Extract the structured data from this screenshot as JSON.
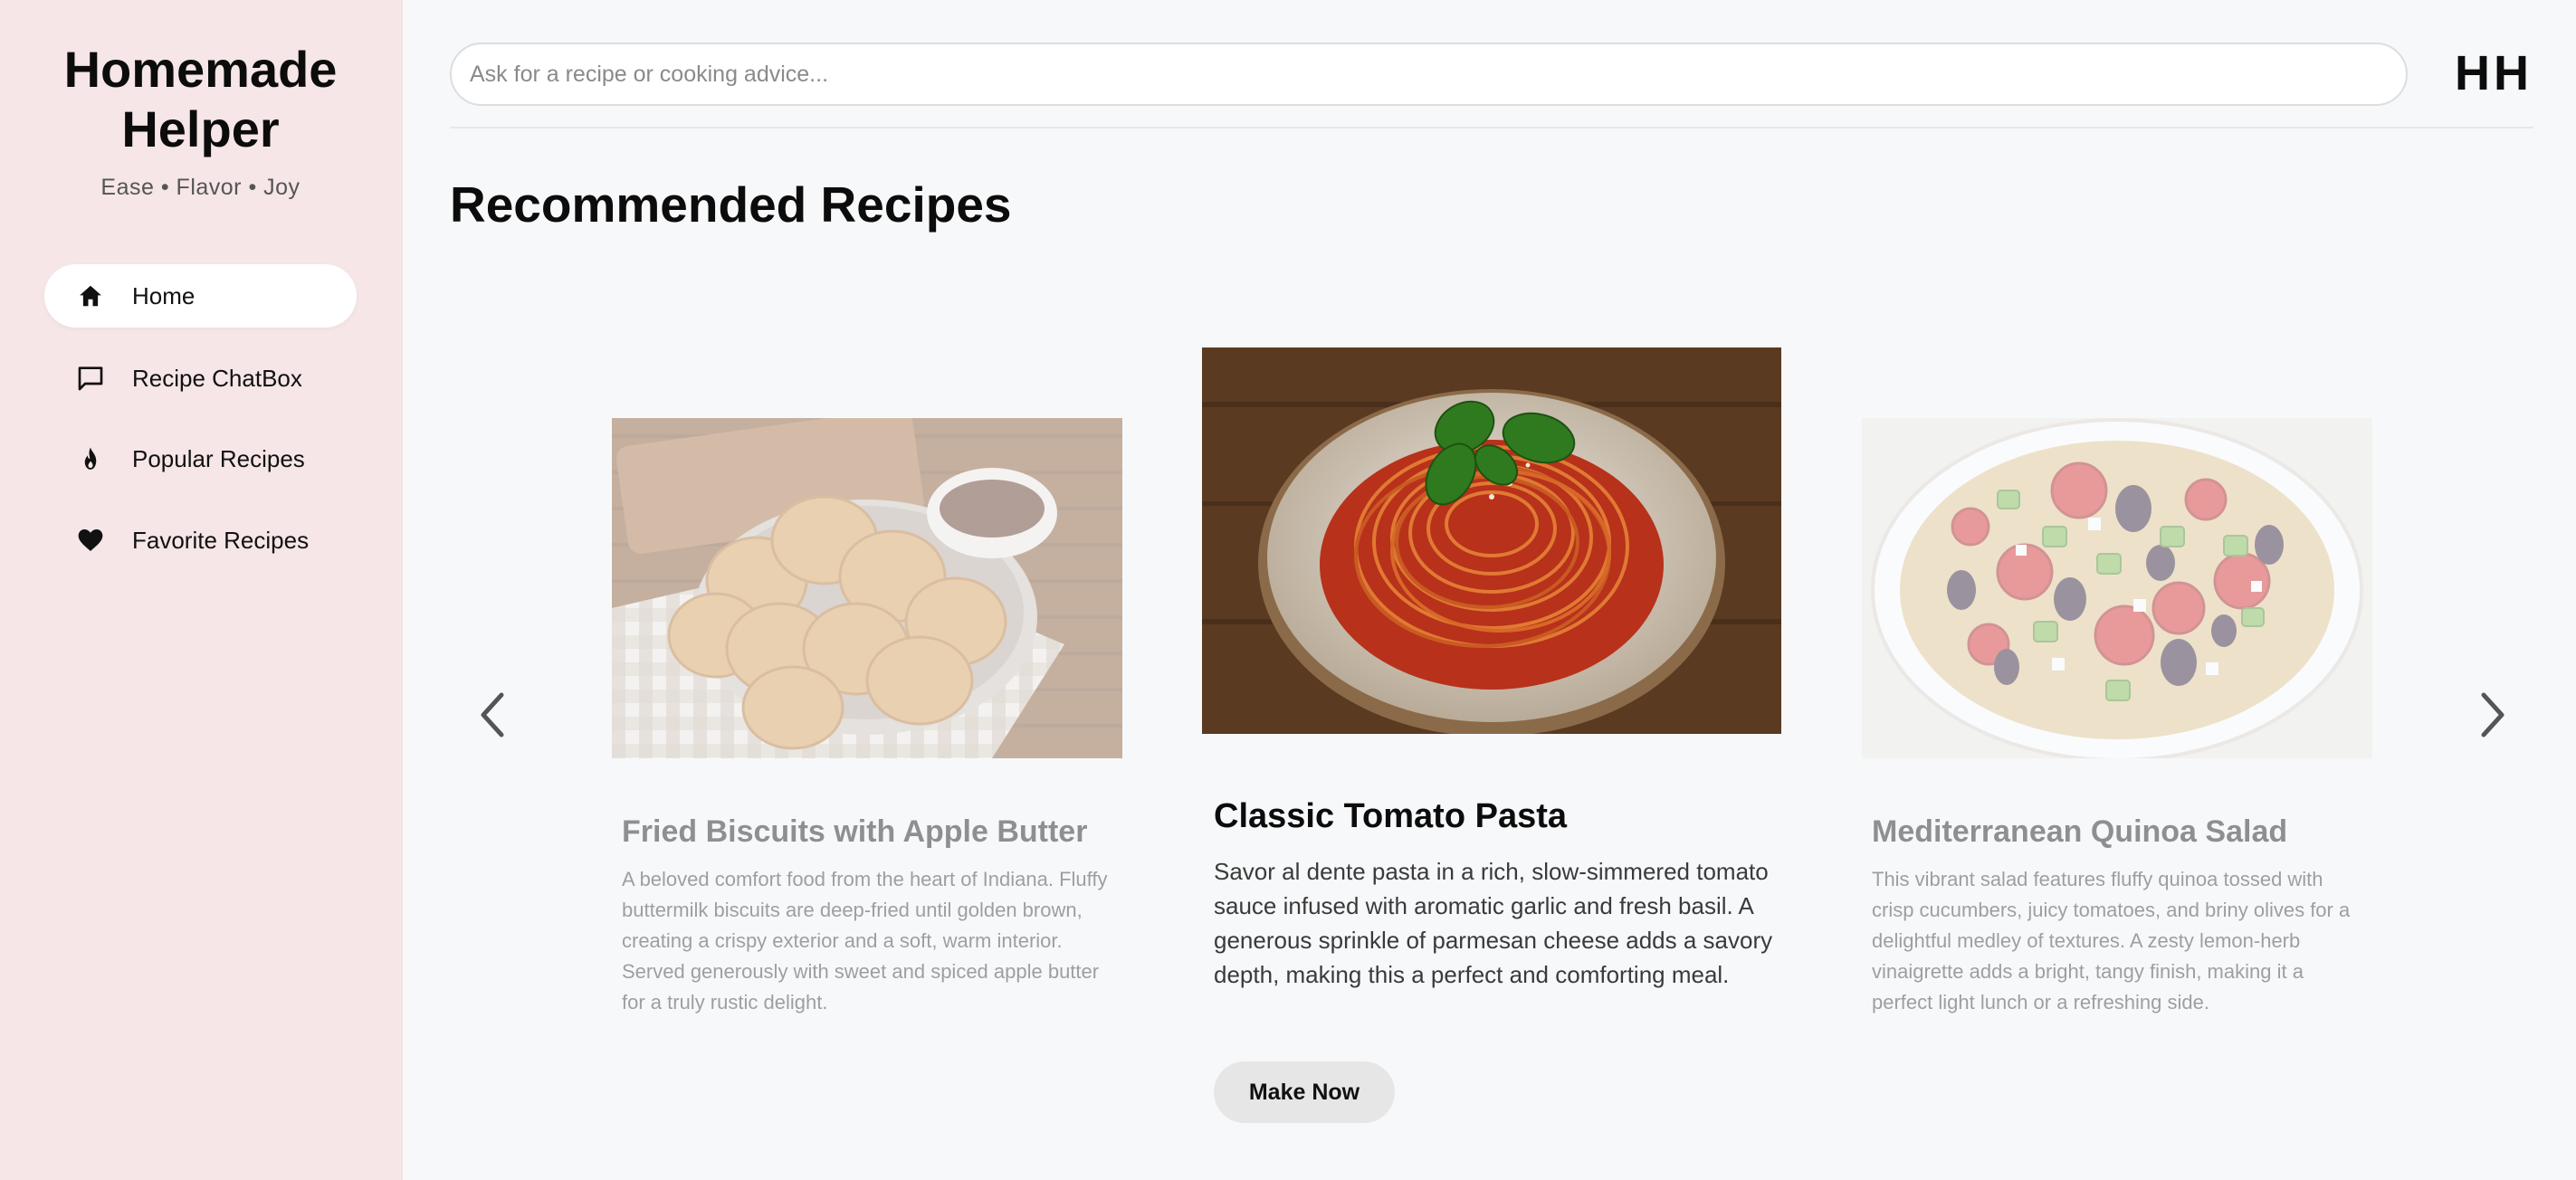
{
  "brand": {
    "title_line1": "Homemade",
    "title_line2": "Helper",
    "tagline": "Ease • Flavor • Joy"
  },
  "nav": [
    {
      "label": "Home",
      "icon": "home-icon",
      "active": true
    },
    {
      "label": "Recipe ChatBox",
      "icon": "chat-icon",
      "active": false
    },
    {
      "label": "Popular Recipes",
      "icon": "fire-icon",
      "active": false
    },
    {
      "label": "Favorite Recipes",
      "icon": "heart-icon",
      "active": false
    }
  ],
  "search": {
    "placeholder": "Ask for a recipe or cooking advice...",
    "value": ""
  },
  "user": {
    "initials": "HH"
  },
  "page_title": "Recommended Recipes",
  "carousel": {
    "prev_icon": "chevron-left-icon",
    "next_icon": "chevron-right-icon",
    "cards": [
      {
        "title": "Fried Biscuits with Apple Butter",
        "description": "A beloved comfort food from the heart of Indiana. Fluffy buttermilk biscuits are deep-fried until golden brown, creating a crispy exterior and a soft, warm interior. Served generously with sweet and spiced apple butter for a truly rustic delight.",
        "image": "fried-biscuits-photo"
      },
      {
        "title": "Classic Tomato Pasta",
        "description": "Savor al dente pasta in a rich, slow-simmered tomato sauce infused with aromatic garlic and fresh basil. A generous sprinkle of parmesan cheese adds a savory depth, making this a perfect and comforting meal.",
        "image": "tomato-pasta-photo",
        "button_label": "Make Now"
      },
      {
        "title": "Mediterranean Quinoa Salad",
        "description": "This vibrant salad features fluffy quinoa tossed with crisp cucumbers, juicy tomatoes, and briny olives for a delightful medley of textures. A zesty lemon-herb vinaigrette adds a bright, tangy finish, making it a perfect light lunch or a refreshing side.",
        "image": "quinoa-salad-photo"
      }
    ]
  },
  "colors": {
    "sidebar_bg": "#f6e6e7",
    "page_bg": "#f7f8fa",
    "button_bg": "#e6e6e6"
  }
}
